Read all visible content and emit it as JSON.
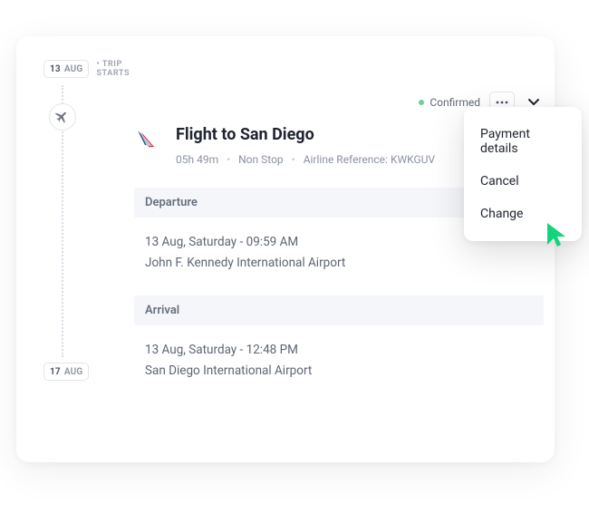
{
  "timeline": {
    "start": {
      "day": "13",
      "month": "AUG",
      "label": "TRIP STARTS"
    },
    "end": {
      "day": "17",
      "month": "AUG"
    }
  },
  "flight": {
    "status": "Confirmed",
    "title": "Flight to San Diego",
    "duration": "05h 49m",
    "stops": "Non Stop",
    "ref_label": "Airline Reference:",
    "ref": "KWKGUV",
    "departure": {
      "label": "Departure",
      "datetime": "13 Aug, Saturday - 09:59 AM",
      "airport": "John F. Kennedy International Airport"
    },
    "arrival": {
      "label": "Arrival",
      "datetime": "13 Aug, Saturday - 12:48 PM",
      "airport": "San Diego International Airport"
    }
  },
  "menu": {
    "items": [
      "Payment details",
      "Cancel",
      "Change"
    ]
  },
  "icons": {
    "plane": "airplane-icon",
    "more": "more-icon",
    "chevron": "chevron-down-icon",
    "airline": "airline-logo"
  }
}
